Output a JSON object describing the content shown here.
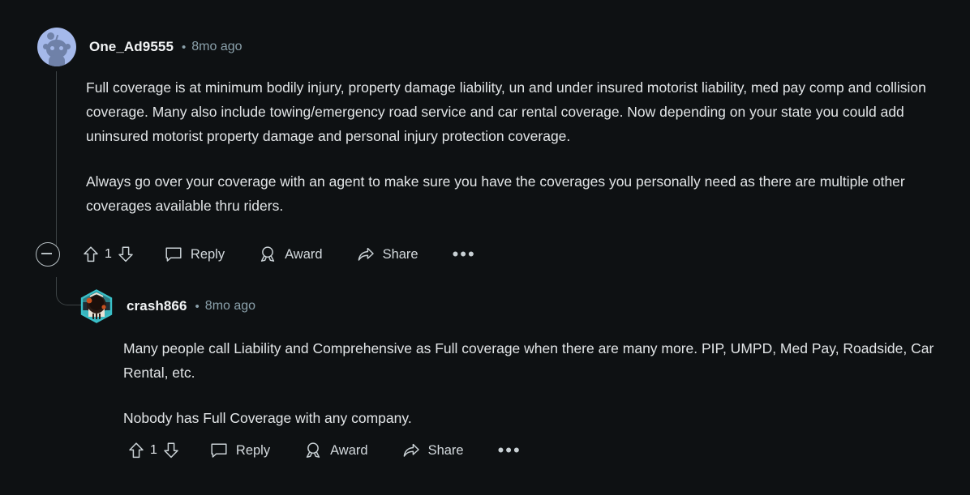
{
  "theme": {
    "background": "#0e1113",
    "body_text": "#e2e5e7",
    "muted_text": "#8ba1ab",
    "action_text": "#d4dade",
    "thread_line": "#3d4345",
    "snoo_avatar_bg": "#a5b9ea",
    "hex_avatar_border": "#39c0c8"
  },
  "comments": [
    {
      "author": "One_Ad9555",
      "separator": "•",
      "timestamp": "8mo ago",
      "avatar": "snoo-avatar",
      "paragraphs": [
        "Full coverage is at minimum bodily injury, property damage liability, un and under insured motorist liability, med pay comp and collision coverage. Many also include towing/emergency road service and car rental coverage. Now depending on your state you could add uninsured motorist property damage and personal injury protection coverage.",
        "Always go over your coverage with an agent to make sure you have the coverages you personally need as there are multiple other coverages available thru riders."
      ],
      "actions": {
        "has_collapse": true,
        "collapse_icon": "minus-circle-icon",
        "upvote_icon": "upvote-arrow-icon",
        "downvote_icon": "downvote-arrow-icon",
        "vote_count": "1",
        "reply_label": "Reply",
        "reply_icon": "comment-bubble-icon",
        "award_label": "Award",
        "award_icon": "award-medal-icon",
        "share_label": "Share",
        "share_icon": "share-arrow-icon",
        "more_label": "•••",
        "more_icon": "overflow-menu-icon"
      }
    },
    {
      "author": "crash866",
      "separator": "•",
      "timestamp": "8mo ago",
      "avatar": "hex-nft-avatar",
      "paragraphs": [
        "Many people call Liability and Comprehensive as Full coverage when there are many more. PIP, UMPD, Med Pay, Roadside, Car Rental, etc.",
        "Nobody has Full Coverage with any company."
      ],
      "actions": {
        "has_collapse": false,
        "upvote_icon": "upvote-arrow-icon",
        "downvote_icon": "downvote-arrow-icon",
        "vote_count": "1",
        "reply_label": "Reply",
        "reply_icon": "comment-bubble-icon",
        "award_label": "Award",
        "award_icon": "award-medal-icon",
        "share_label": "Share",
        "share_icon": "share-arrow-icon",
        "more_label": "•••",
        "more_icon": "overflow-menu-icon"
      }
    }
  ]
}
